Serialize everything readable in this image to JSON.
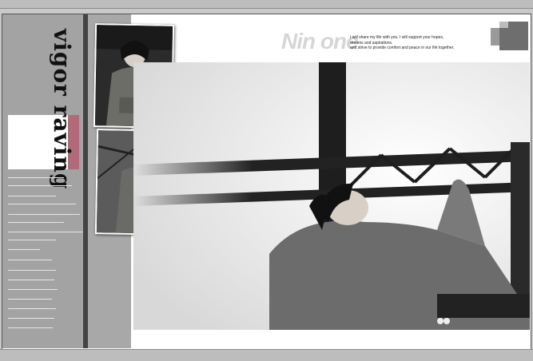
{
  "vertical_title": "vigor raving",
  "brand_text": "Nin one",
  "caption_lines": [
    "I will share my life with you. I will support your hopes,",
    "dreams and aspirations.",
    "and strive to provide comfort and peace in our life together."
  ],
  "colors": {
    "accent": "#b06a7a",
    "panel": "#a3a3a3",
    "brand_text": "#d6d6d6"
  }
}
